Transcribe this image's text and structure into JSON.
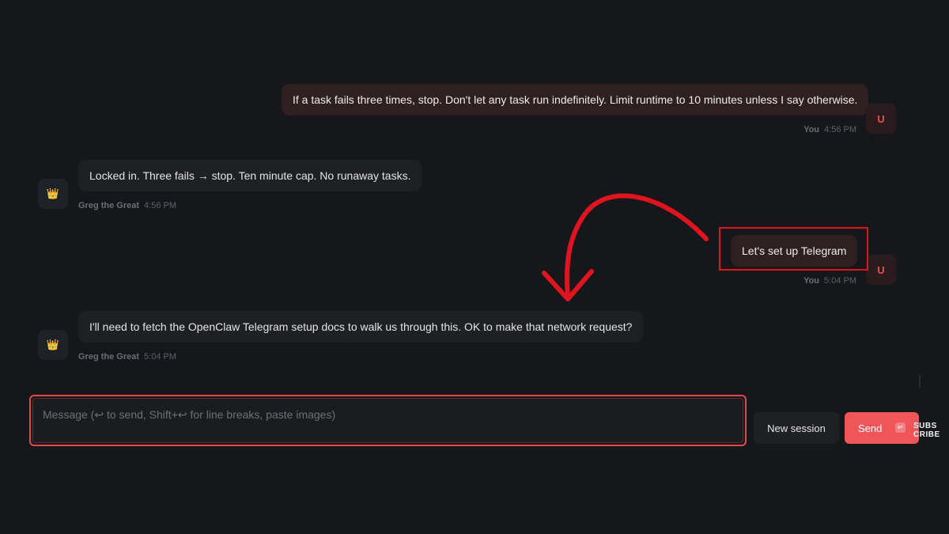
{
  "messages": [
    {
      "role": "user",
      "text": "If a task fails three times, stop. Don't let any task run indefinitely. Limit runtime to 10 minutes unless I say otherwise.",
      "sender": "You",
      "time": "4:56 PM",
      "avatar": "U"
    },
    {
      "role": "assistant",
      "text": "Locked in. Three fails → stop. Ten minute cap. No runaway tasks.",
      "sender": "Greg the Great",
      "time": "4:56 PM",
      "avatar": "👑"
    },
    {
      "role": "user",
      "text": "Let's set up Telegram",
      "sender": "You",
      "time": "5:04 PM",
      "avatar": "U"
    },
    {
      "role": "assistant",
      "text": "I'll need to fetch the OpenClaw Telegram setup docs to walk us through this. OK to make that network request?",
      "sender": "Greg the Great",
      "time": "5:04 PM",
      "avatar": "👑"
    }
  ],
  "composer": {
    "placeholder": "Message (↩ to send, Shift+↩ for line breaks, paste images)",
    "new_session_label": "New session",
    "send_label": "Send",
    "send_key_hint": "↵"
  },
  "overlay": {
    "subscribe_line1": "SUBS",
    "subscribe_line2": "CRIBE",
    "annotation_color": "#e0141f"
  },
  "colors": {
    "background": "#16171b",
    "accent": "#f0555a",
    "user_bubble": "#2e1f21",
    "assistant_bubble": "#1e2024"
  }
}
